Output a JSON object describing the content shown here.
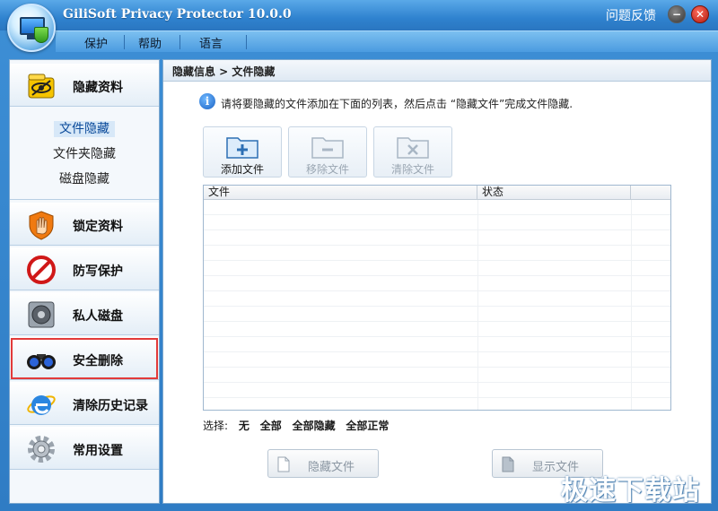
{
  "app": {
    "title": "GiliSoft Privacy Protector 10.0.0",
    "feedback": "问题反馈"
  },
  "menu": {
    "items": [
      "保护",
      "帮助",
      "语言"
    ]
  },
  "sidebar": {
    "hide": "隐藏资料",
    "sub": [
      "文件隐藏",
      "文件夹隐藏",
      "磁盘隐藏"
    ],
    "lock": "锁定资料",
    "protect": "防写保护",
    "disk": "私人磁盘",
    "shred": "安全删除",
    "history": "清除历史记录",
    "settings": "常用设置"
  },
  "main": {
    "breadcrumb": "隐藏信息 > 文件隐藏",
    "info": "请将要隐藏的文件添加在下面的列表，然后点击 “隐藏文件”完成文件隐藏.",
    "toolbar": {
      "add": "添加文件",
      "remove": "移除文件",
      "clear": "清除文件"
    },
    "columns": [
      "文件",
      "状态"
    ],
    "select": {
      "label": "选择:",
      "none": "无",
      "all": "全部",
      "all_hidden": "全部隐藏",
      "all_normal": "全部正常"
    },
    "hide_button": "隐藏文件",
    "show_button": "显示文件"
  },
  "watermark": "极速下载站",
  "colors": {
    "accent": "#2f82cf",
    "highlight": "#e23a3a"
  }
}
